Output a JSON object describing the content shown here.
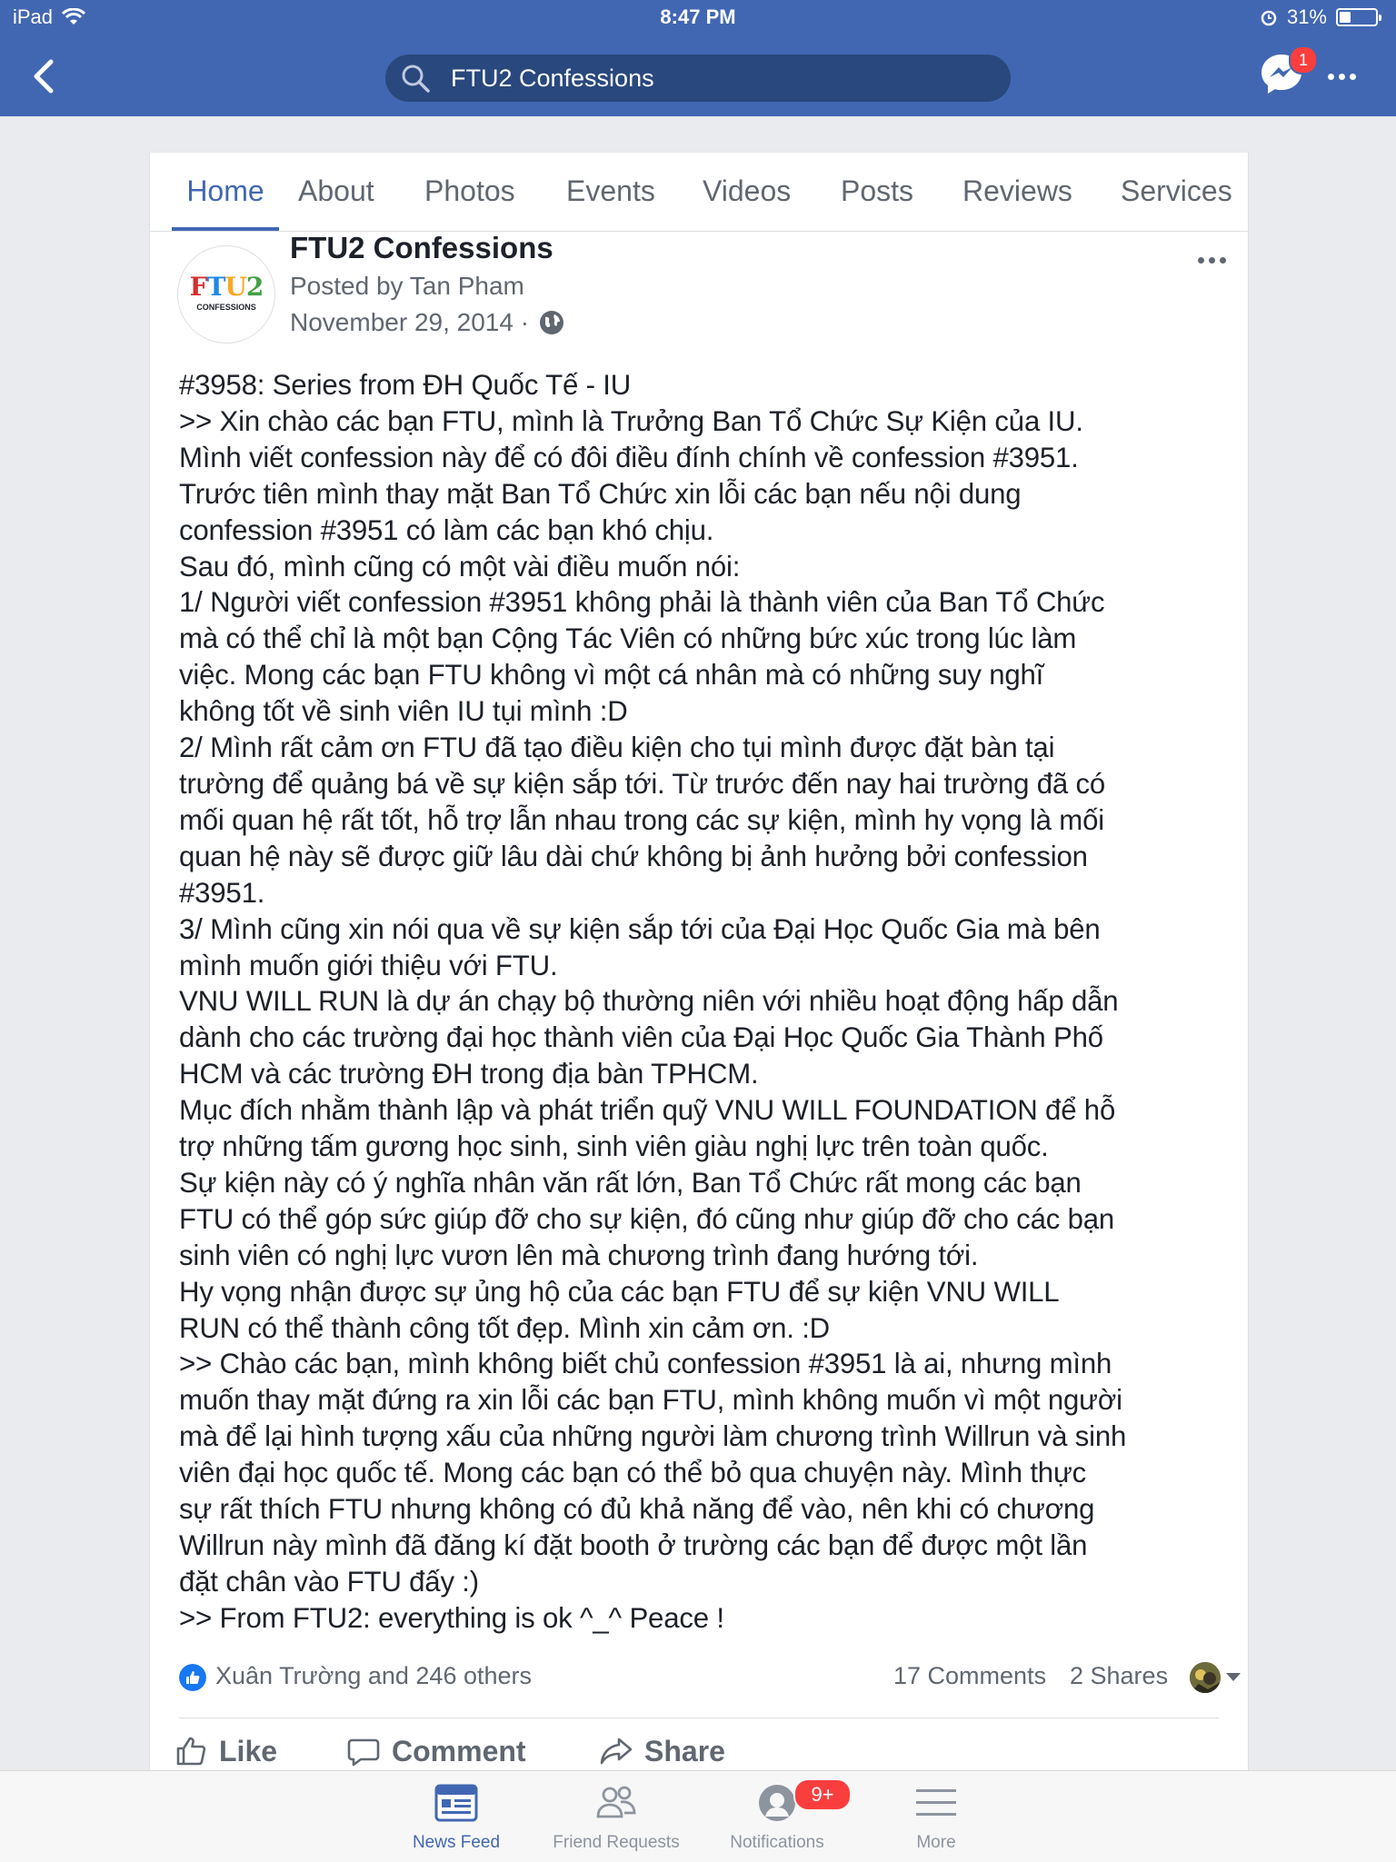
{
  "status_bar": {
    "device": "iPad",
    "time": "8:47 PM",
    "battery": "31%",
    "battery_level": 0.31
  },
  "nav": {
    "search_text": "FTU2 Confessions",
    "messenger_badge": "1"
  },
  "tabs": [
    "Home",
    "About",
    "Photos",
    "Events",
    "Videos",
    "Posts",
    "Reviews",
    "Services"
  ],
  "post": {
    "page_name": "FTU2 Confessions",
    "posted_by": "Posted by Tan Pham",
    "date": "November 29, 2014 ·",
    "avatar_logo_text": "FTU2",
    "avatar_logo_sub": "CONFESSIONS",
    "lines": [
      "#3958: Series from ĐH Quốc Tế - IU",
      ">> Xin chào các bạn FTU, mình là Trưởng Ban Tổ Chức Sự Kiện của IU.",
      "Mình viết confession này để có đôi điều đính chính về confession #3951.",
      "Trước tiên mình thay mặt Ban Tổ Chức xin lỗi các bạn nếu nội dung",
      "confession #3951 có làm các bạn khó chịu.",
      "Sau đó, mình cũng có một vài điều muốn nói:",
      "1/ Người viết confession #3951 không phải là thành viên của Ban Tổ Chức",
      "mà có thể chỉ là một bạn Cộng Tác Viên có những bức xúc trong lúc làm",
      "việc. Mong các bạn FTU không vì một cá nhân mà có những suy nghĩ",
      "không tốt về sinh viên IU tụi mình :D",
      "2/ Mình rất cảm ơn FTU đã tạo điều kiện cho tụi mình được đặt bàn tại",
      "trường để quảng bá về sự kiện sắp tới. Từ trước đến nay hai trường đã có",
      "mối quan hệ rất tốt, hỗ trợ lẫn nhau trong các sự kiện, mình hy vọng là mối",
      "quan hệ này sẽ được giữ lâu dài chứ không bị ảnh hưởng bởi confession",
      "#3951.",
      "3/ Mình cũng xin nói qua về sự kiện sắp tới của Đại Học Quốc Gia mà bên",
      "mình muốn giới thiệu với FTU.",
      "VNU WILL RUN  là dự án chạy bộ thường niên với nhiều hoạt động hấp dẫn",
      "dành cho các trường đại học thành viên của Đại Học Quốc Gia Thành Phố",
      "HCM và các trường ĐH trong địa bàn TPHCM.",
      "Mục đích nhằm thành lập và phát triển quỹ VNU WILL FOUNDATION để hỗ",
      "trợ những tấm gương  học sinh, sinh viên giàu nghị lực trên toàn quốc.",
      "Sự kiện này có ý nghĩa nhân văn rất lớn, Ban Tổ Chức rất mong các bạn",
      "FTU có thể góp sức giúp đỡ cho sự kiện, đó cũng như giúp đỡ cho các bạn",
      "sinh viên có nghị lực vươn lên mà chương trình đang hướng tới.",
      "Hy vọng nhận được sự ủng hộ của các bạn FTU  để sự kiện VNU WILL",
      "RUN có thể thành công tốt đẹp. Mình xin cảm ơn. :D",
      ">> Chào các bạn, mình không biết chủ confession #3951 là ai, nhưng mình",
      "muốn thay mặt đứng ra xin lỗi các bạn FTU, mình không muốn vì một người",
      "mà để lại hình tượng xấu của những người làm chương trình Willrun và sinh",
      "viên đại học quốc tế. Mong các bạn có thể bỏ qua chuyện này. Mình thực",
      "sự rất thích FTU nhưng không có đủ khả năng để vào, nên khi có chương",
      "Willrun này mình đã đăng kí đặt booth ở trường các bạn để được một lần",
      "đặt chân vào FTU đấy :)",
      ">> From FTU2: everything is ok ^_^ Peace !"
    ],
    "reactions_text": "Xuân Trường and 246 others",
    "comments": "17 Comments",
    "shares": "2 Shares",
    "actions": {
      "like": "Like",
      "comment": "Comment",
      "share": "Share"
    }
  },
  "bottom_tabs": {
    "news_feed": "News Feed",
    "friend_requests": "Friend Requests",
    "notifications": "Notifications",
    "notifications_badge": "9+",
    "more": "More"
  },
  "colors": {
    "brand_blue": "#4267b2",
    "badge_red": "#fa3e3e",
    "background": "#e9ebee"
  }
}
